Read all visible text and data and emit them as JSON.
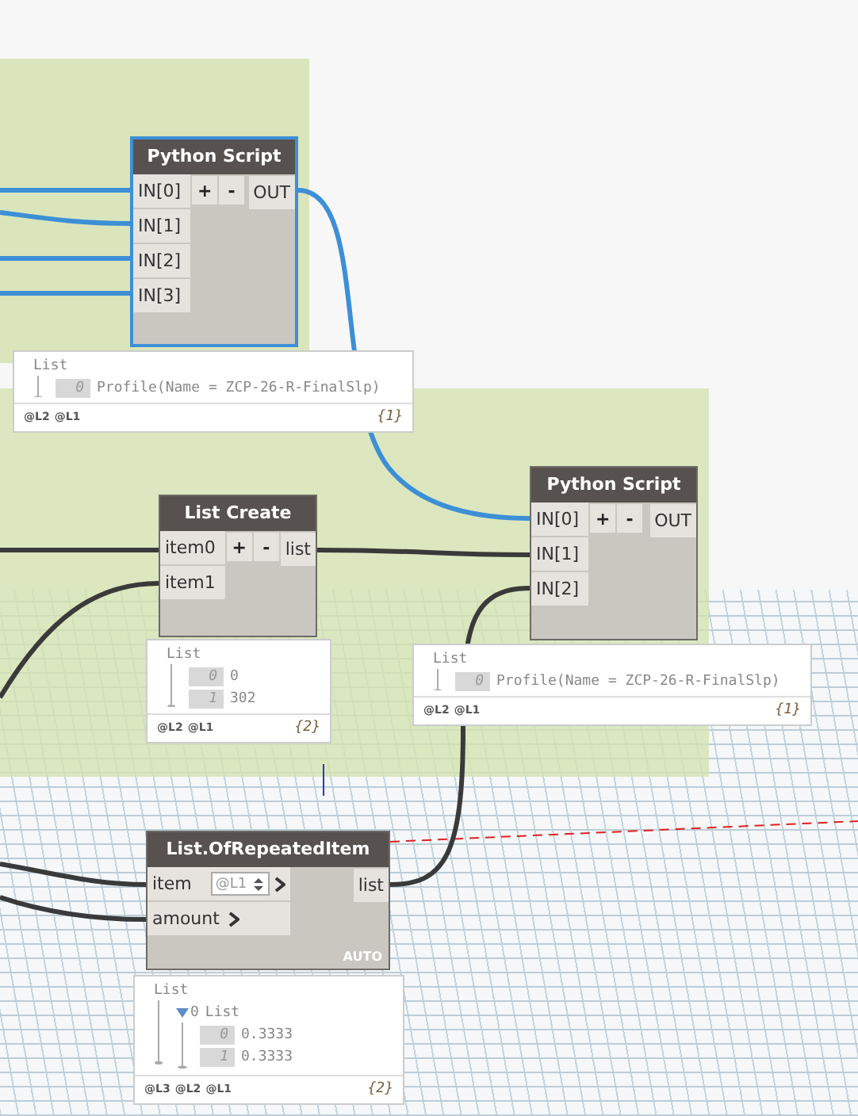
{
  "nodes": [
    {
      "kind": "python",
      "title": "Python Script",
      "selected": true,
      "inputs": [
        {
          "name": "IN[0]"
        },
        {
          "name": "IN[1]"
        },
        {
          "name": "IN[2]"
        },
        {
          "name": "IN[3]"
        }
      ],
      "add": "+",
      "remove": "-",
      "output": "OUT"
    },
    {
      "kind": "python",
      "title": "List Create",
      "selected": false,
      "inputs": [
        {
          "name": "item0"
        },
        {
          "name": "item1"
        }
      ],
      "add": "+",
      "remove": "-",
      "output": "list"
    },
    {
      "kind": "python",
      "title": "Python Script",
      "selected": false,
      "inputs": [
        {
          "name": "IN[0]"
        },
        {
          "name": "IN[1]"
        },
        {
          "name": "IN[2]"
        }
      ],
      "add": "+",
      "remove": "-",
      "output": "OUT"
    },
    {
      "kind": "function",
      "title": "List.OfRepeatedItem",
      "selected": false,
      "inputs": [
        {
          "name": "item",
          "lacing": "@L1"
        },
        {
          "name": "amount"
        }
      ],
      "output": "list",
      "mode": "AUTO"
    }
  ],
  "previews": [
    {
      "header": "List",
      "items": [
        {
          "index": "0",
          "value": "Profile(Name = ZCP-26-R-FinalSlp)"
        }
      ],
      "levels": [
        "@L2",
        "@L1"
      ],
      "count": "{1}"
    },
    {
      "header": "List",
      "items": [
        {
          "index": "0",
          "value": "0"
        },
        {
          "index": "1",
          "value": "302"
        }
      ],
      "levels": [
        "@L2",
        "@L1"
      ],
      "count": "{2}"
    },
    {
      "header": "List",
      "items": [
        {
          "index": "0",
          "value": "Profile(Name = ZCP-26-R-FinalSlp)"
        }
      ],
      "levels": [
        "@L2",
        "@L1"
      ],
      "count": "{1}"
    },
    {
      "header": "List",
      "items": [
        {
          "index": "0",
          "value": "List",
          "children": [
            {
              "index": "0",
              "value": "0.3333"
            },
            {
              "index": "1",
              "value": "0.3333"
            }
          ]
        }
      ],
      "levels": [
        "@L3",
        "@L2",
        "@L1"
      ],
      "count": "{2}"
    }
  ]
}
